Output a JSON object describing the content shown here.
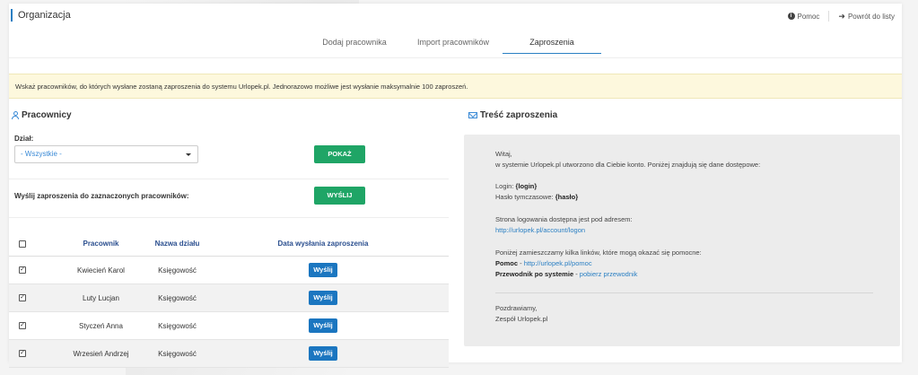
{
  "header": {
    "title": "Organizacja",
    "help_label": "Pomoc",
    "back_label": "Powrót do listy"
  },
  "tabs": [
    {
      "label": "Dodaj pracownika",
      "active": false
    },
    {
      "label": "Import pracowników",
      "active": false
    },
    {
      "label": "Zaproszenia",
      "active": true
    }
  ],
  "info_text": "Wskaż pracowników, do których wysłane zostaną zaproszenia do systemu Urlopek.pl. Jednorazowo możliwe jest wysłanie maksymalnie 100 zaproszeń.",
  "employees_section": {
    "title": "Pracownicy",
    "dept_label": "Dział:",
    "dept_selected": "- Wszystkie -",
    "show_button": "POKAŻ",
    "send_label": "Wyślij zaproszenia do zaznaczonych pracowników:",
    "send_button": "WYŚLIJ"
  },
  "table": {
    "headers": {
      "name": "Pracownik",
      "dept": "Nazwa działu",
      "date": "Data wysłania zaproszenia"
    },
    "rows": [
      {
        "name": "Kwiecień Karol",
        "dept": "Księgowość",
        "action": "Wyślij",
        "checked": true
      },
      {
        "name": "Luty Lucjan",
        "dept": "Księgowość",
        "action": "Wyślij",
        "checked": true
      },
      {
        "name": "Styczeń Anna",
        "dept": "Księgowość",
        "action": "Wyślij",
        "checked": true
      },
      {
        "name": "Wrzesień Andrzej",
        "dept": "Księgowość",
        "action": "Wyślij",
        "checked": true
      }
    ]
  },
  "invitation": {
    "title": "Treść zaproszenia",
    "greeting": "Witaj,",
    "intro": "w systemie Urlopek.pl utworzono dla Ciebie konto. Poniżej znajdują się dane dostępowe:",
    "login_label": "Login:",
    "login_value": "{login}",
    "password_label": "Hasło tymczasowe:",
    "password_value": "{hasło}",
    "login_page_text": "Strona logowania dostępna jest pod adresem:",
    "login_page_url": "http://urlopek.pl/account/logon",
    "links_intro": "Poniżej zamieszczamy kilka linków, które mogą okazać się pomocne:",
    "help_label": "Pomoc",
    "help_sep": " - ",
    "help_url": "http://urlopek.pl/pomoc",
    "guide_label": "Przewodnik po systemie",
    "guide_sep": " - ",
    "guide_link": "pobierz przewodnik",
    "regards": "Pozdrawiamy,",
    "signature": "Zespół Urlopek.pl"
  }
}
